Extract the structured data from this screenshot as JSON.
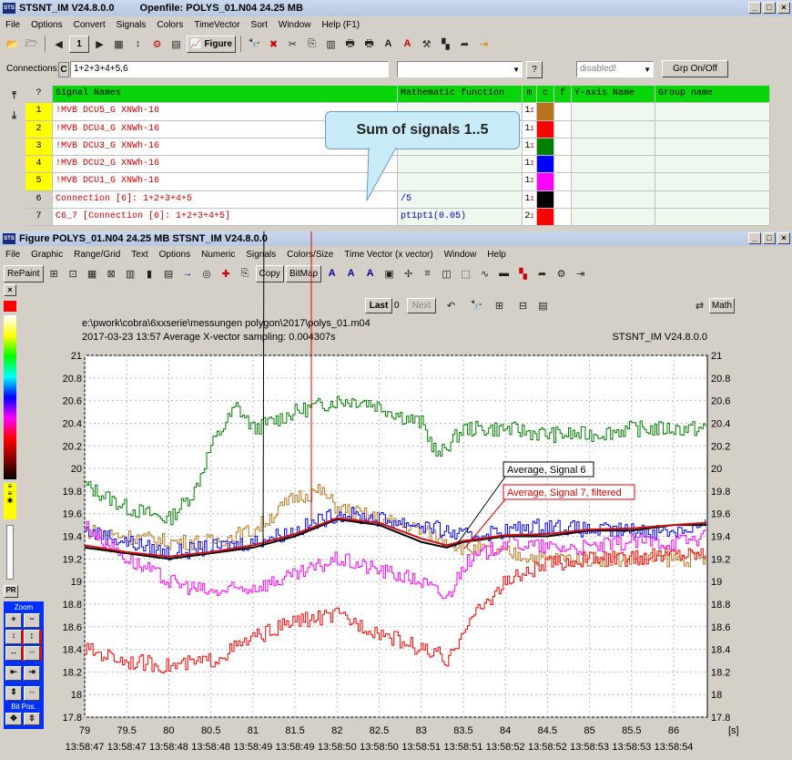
{
  "main_window": {
    "title": "STSNT_IM V24.8.0.0",
    "openfile": "Openfile: POLYS_01.N04  24.25 MB",
    "menu": [
      "File",
      "Options",
      "Convert",
      "Signals",
      "Colors",
      "TimeVector",
      "Sort",
      "Window",
      "Help (F1)"
    ],
    "page_number": "1",
    "figure_label": "Figure"
  },
  "connections": {
    "label": "Connections:",
    "prefix": "C",
    "value": "1+2+3+4+5,6",
    "disabled": "disabled!",
    "help": "?",
    "grp_button": "Grp On/Off"
  },
  "grid": {
    "headers": {
      "q": "?",
      "signal_names": "Signal Names",
      "math": "Mathematic function",
      "m": "m",
      "c": "c",
      "f": "f",
      "yaxis": "Y-axis Name",
      "group": "Group name"
    },
    "rows": [
      {
        "num": "1",
        "name": "!MVB     DCU5_G           XNWh-16",
        "math": "",
        "m": "1",
        "color": "#b8741a"
      },
      {
        "num": "2",
        "name": "!MVB     DCU4_G           XNWh-16",
        "math": "",
        "m": "1",
        "color": "#ff0000"
      },
      {
        "num": "3",
        "name": "!MVB     DCU3_G           XNWh-16",
        "math": "",
        "m": "1",
        "color": "#008000"
      },
      {
        "num": "4",
        "name": "!MVB     DCU2_G           XNWh-16",
        "math": "",
        "m": "1",
        "color": "#0000ff"
      },
      {
        "num": "5",
        "name": "!MVB     DCU1_G           XNWh-16",
        "math": "",
        "m": "1",
        "color": "#ff00ff"
      },
      {
        "num": "6",
        "name": "Connection [6]: 1+2+3+4+5",
        "math": "/5",
        "m": "1",
        "color": "#000000"
      },
      {
        "num": "7",
        "name": "C6_7 [Connection [6]: 1+2+3+4+5]",
        "math": "pt1pt1(0.05)",
        "m": "2",
        "color": "#ff0000"
      }
    ]
  },
  "callout": "Sum of signals 1..5",
  "figure_window": {
    "title": "Figure POLYS_01.N04  24.25 MB  STSNT_IM V24.8.0.0",
    "menu": [
      "File",
      "Graphic",
      "Range/Grid",
      "Text",
      "Options",
      "Numeric",
      "Signals",
      "Colors/Size",
      "Time Vector (x vector)",
      "Window",
      "Help"
    ],
    "repaint": "RePaint",
    "copy": "Copy",
    "bitmap": "BitMap",
    "last": "Last",
    "last_value": "0",
    "next": "Next",
    "math": "Math",
    "side": {
      "pr": "PR",
      "zoom": "Zoom",
      "bitpos": "Bit Pos."
    }
  },
  "chart_data": {
    "type": "line",
    "path_text": "e:\\pwork\\cobra\\6xxserie\\messungen polygon\\2017\\polys_01.m04",
    "info_text": "2017-03-23 13:57    Average X-vector sampling: 0.004307s",
    "version_text": "STSNT_IM V24.8.0.0",
    "xlim": [
      79,
      86.4
    ],
    "ylim": [
      17.8,
      21.0
    ],
    "xticks": [
      "79",
      "79.5",
      "80",
      "80.5",
      "81",
      "81.5",
      "82",
      "82.5",
      "83",
      "83.5",
      "84",
      "84.5",
      "85",
      "85.5",
      "86"
    ],
    "time_ticks": [
      "13:58:47",
      "13:58:47",
      "13:58:48",
      "13:58:48",
      "13:58:49",
      "13:58:49",
      "13:58:50",
      "13:58:50",
      "13:58:51",
      "13:58:51",
      "13:58:52",
      "13:58:52",
      "13:58:53",
      "13:58:53",
      "13:58:54"
    ],
    "yticks": [
      "21",
      "20.8",
      "20.6",
      "20.4",
      "20.2",
      "20",
      "19.8",
      "19.6",
      "19.4",
      "19.2",
      "19",
      "18.8",
      "18.6",
      "18.4",
      "18.2",
      "18",
      "17.8"
    ],
    "xunit": "[s]",
    "annotations": [
      "Average, Signal 6",
      "Average, Signal 7, filtered"
    ],
    "series": [
      {
        "color": "#008000",
        "x": [
          79,
          79.5,
          80,
          80.3,
          80.5,
          80.8,
          81,
          81.5,
          82,
          82.3,
          82.5,
          82.8,
          83,
          83.2,
          83.3,
          83.5,
          84,
          84.5,
          85,
          85.5,
          86,
          86.4
        ],
        "y": [
          19.85,
          19.65,
          19.55,
          19.8,
          20.2,
          20.55,
          20.35,
          20.5,
          20.6,
          20.6,
          20.55,
          20.45,
          20.4,
          20.1,
          20.2,
          20.35,
          20.35,
          20.3,
          20.3,
          20.35,
          20.35,
          20.35
        ]
      },
      {
        "color": "#b8741a",
        "x": [
          79,
          79.5,
          80,
          80.5,
          81,
          81.5,
          81.8,
          82,
          82.5,
          83,
          83.5,
          84,
          84.5,
          85,
          85.5,
          86,
          86.4
        ],
        "y": [
          19.45,
          19.4,
          19.35,
          19.35,
          19.45,
          19.75,
          19.8,
          19.65,
          19.55,
          19.45,
          19.3,
          19.25,
          19.2,
          19.2,
          19.2,
          19.2,
          19.2
        ]
      },
      {
        "color": "#0000ff",
        "x": [
          79,
          79.5,
          80,
          80.5,
          81,
          81.5,
          82,
          82.5,
          83,
          83.5,
          84,
          84.5,
          85,
          85.5,
          86,
          86.4
        ],
        "y": [
          19.45,
          19.35,
          19.25,
          19.3,
          19.35,
          19.45,
          19.6,
          19.55,
          19.5,
          19.4,
          19.45,
          19.5,
          19.45,
          19.45,
          19.45,
          19.5
        ]
      },
      {
        "color": "#ff00ff",
        "x": [
          79,
          79.5,
          80,
          80.5,
          81,
          81.5,
          82,
          82.5,
          83,
          83.3,
          83.5,
          84,
          84.5,
          85,
          85.5,
          86,
          86.4
        ],
        "y": [
          19.5,
          19.2,
          19.0,
          18.9,
          18.95,
          19.05,
          19.2,
          19.1,
          19.0,
          18.85,
          19.15,
          19.35,
          19.3,
          19.3,
          19.35,
          19.35,
          19.4
        ]
      },
      {
        "color": "#ff0000",
        "x": [
          79,
          79.5,
          80,
          80.5,
          81,
          81.5,
          82,
          82.5,
          83,
          83.2,
          83.3,
          83.5,
          84,
          84.5,
          85,
          85.5,
          86,
          86.4
        ],
        "y": [
          18.4,
          18.3,
          18.25,
          18.3,
          18.5,
          18.65,
          18.7,
          18.55,
          18.4,
          18.35,
          18.25,
          18.6,
          19.0,
          19.15,
          19.2,
          19.2,
          19.25,
          19.25
        ]
      },
      {
        "color": "#000000",
        "x": [
          79,
          79.5,
          80,
          80.5,
          81,
          81.5,
          82,
          82.5,
          83,
          83.3,
          83.5,
          84,
          84.5,
          85,
          85.5,
          86,
          86.4
        ],
        "y": [
          19.3,
          19.25,
          19.2,
          19.25,
          19.3,
          19.4,
          19.55,
          19.5,
          19.35,
          19.3,
          19.35,
          19.4,
          19.4,
          19.45,
          19.45,
          19.5,
          19.5
        ]
      },
      {
        "color": "#d01010",
        "x": [
          79,
          79.5,
          80,
          80.5,
          81,
          81.5,
          82,
          82.5,
          83,
          83.3,
          83.5,
          84,
          84.5,
          85,
          85.5,
          86,
          86.4
        ],
        "y": [
          19.32,
          19.26,
          19.22,
          19.26,
          19.32,
          19.42,
          19.56,
          19.52,
          19.38,
          19.32,
          19.36,
          19.41,
          19.42,
          19.46,
          19.47,
          19.5,
          19.52
        ]
      }
    ]
  }
}
